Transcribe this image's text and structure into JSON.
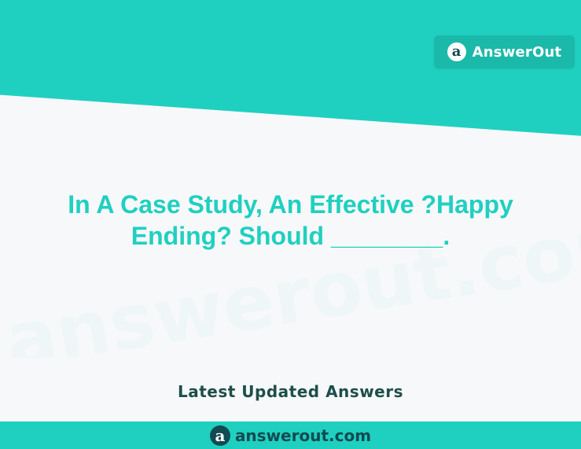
{
  "brand": {
    "logo_letter": "a",
    "name": "AnswerOut"
  },
  "question": {
    "text": "In A Case Study, An Effective ?Happy Ending? Should ________."
  },
  "watermark": {
    "text": "answerout.com"
  },
  "subtitle": "Latest Updated Answers",
  "footer": {
    "logo_letter": "a",
    "site": "answerout.com"
  },
  "colors": {
    "accent": "#1fd0c0",
    "badge": "#1bb9aa",
    "dark_text": "#124a52",
    "background": "#f7f8fa"
  }
}
